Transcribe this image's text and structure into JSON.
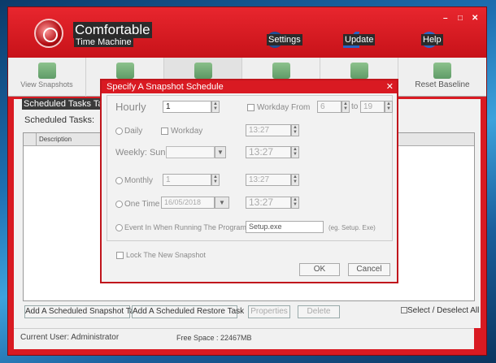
{
  "window": {
    "title_line1": "Comfortable",
    "title_line2": "Time Machine",
    "controls": [
      "–",
      "□",
      "✕"
    ]
  },
  "topbar": {
    "settings": "Settings",
    "update": "Update",
    "help": "Help"
  },
  "toolbar": {
    "view_snapshots": "View Snapshots",
    "reset_baseline": "Reset Baseline"
  },
  "main": {
    "panel_header": "Scheduled Tasks Take Snapshot By Scheduled Task",
    "scheduled_tasks_label": "Scheduled Tasks:",
    "column_description": "Description",
    "btn_add_snapshot_task": "Add A Scheduled Snapshot Task",
    "btn_add_restore_task": "Add A Scheduled Restore Task",
    "btn_properties": "Properties",
    "btn_delete": "Delete",
    "select_all": "Select / Deselect All"
  },
  "status": {
    "user": "Current User: Administrator",
    "free_space": "Free Space : 22467MB"
  },
  "dialog": {
    "title": "Specify A Snapshot Schedule",
    "close": "✕",
    "hourly": "Hourly",
    "hourly_value": "1",
    "workday_from": "Workday From",
    "from_value": "6",
    "to": "to",
    "to_value": "19",
    "daily": "Daily",
    "workday": "Workday",
    "daily_time": "13:27",
    "weekly": "Weekly: Sunday",
    "weekly_time": "13:27",
    "monthly": "Monthly",
    "monthly_value": "1",
    "monthly_time": "13:27",
    "one_time": "One Time",
    "one_time_date": "16/05/2018",
    "one_time_time": "13:27",
    "event": "Event In When Running The Program",
    "event_program": "Setup.exe",
    "event_example": "(eg. Setup. Exe)",
    "lock": "Lock The New Snapshot",
    "ok": "OK",
    "cancel": "Cancel"
  }
}
